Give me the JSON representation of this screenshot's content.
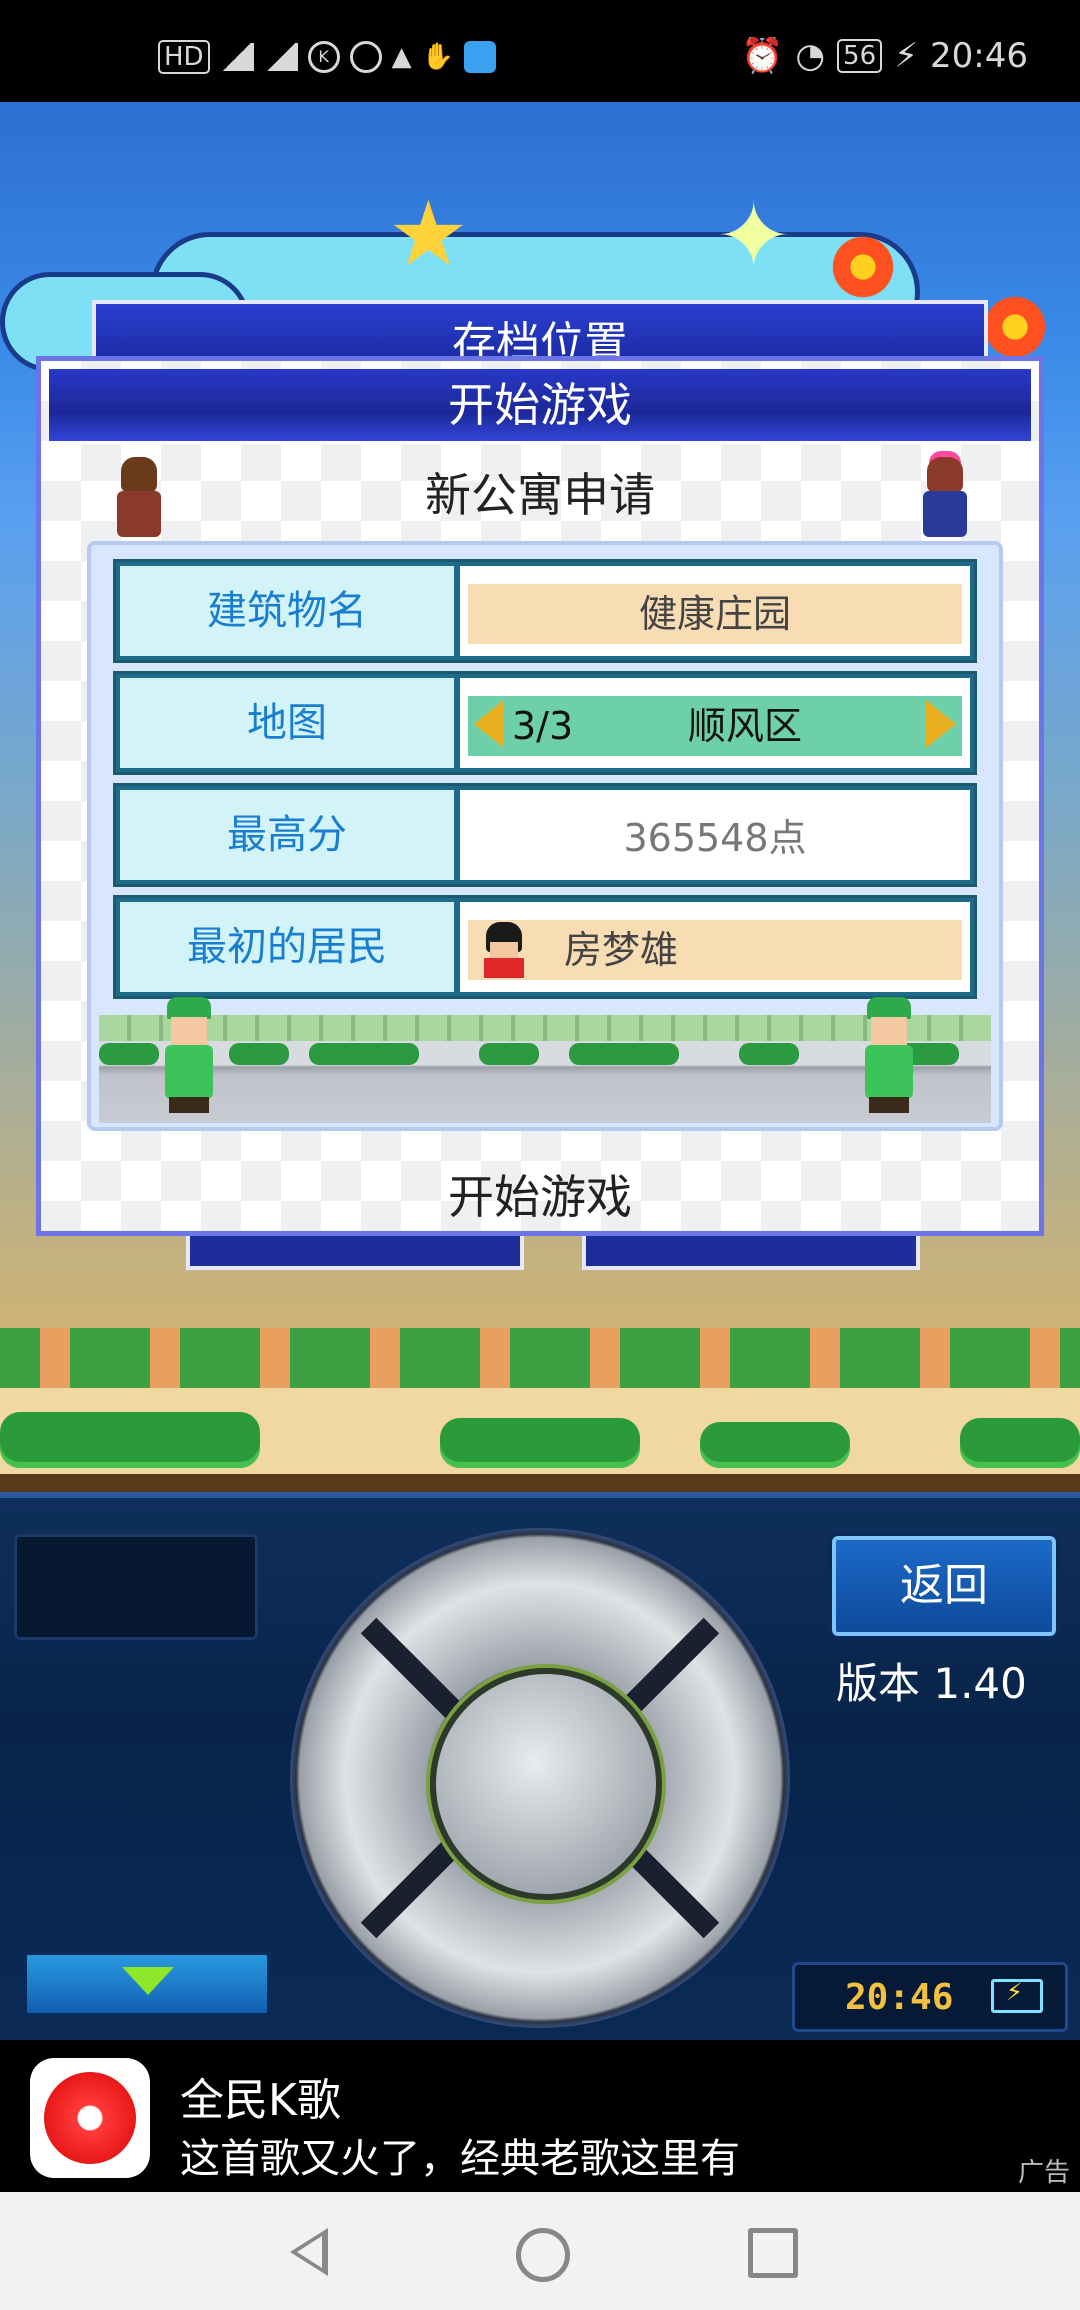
{
  "status_bar": {
    "left_icons": [
      "hd-icon",
      "signal-icon",
      "4g-signal-icon",
      "k-app-icon",
      "timer-icon",
      "qq-icon",
      "hand-icon",
      "app-icon"
    ],
    "network_label": "HD",
    "battery": "56",
    "time": "20:46"
  },
  "game": {
    "background_panel_title": "存档位置",
    "dialog": {
      "title": "开始游戏",
      "subtitle": "新公寓申请",
      "rows": [
        {
          "label": "建筑物名",
          "value": "健康庄园"
        },
        {
          "label": "地图",
          "map_index": "3/3",
          "map_name": "顺风区"
        },
        {
          "label": "最高分",
          "value": "365548点"
        },
        {
          "label": "最初的居民",
          "value": "房梦雄"
        }
      ],
      "start_button": "开始游戏"
    },
    "controls": {
      "back_button": "返回",
      "version": "版本 1.40",
      "clock": "20:46"
    }
  },
  "ad": {
    "title": "全民K歌",
    "description": "这首歌又火了，经典老歌这里有",
    "tag": "广告"
  },
  "colors": {
    "dialog_title_bg": "#1c2898",
    "label_text": "#1a7ed0",
    "label_bg": "#d2f4f8",
    "tan_value_bg": "#f8dcb4",
    "map_value_bg": "#6ed0a8",
    "clock_text": "#f4c040"
  }
}
